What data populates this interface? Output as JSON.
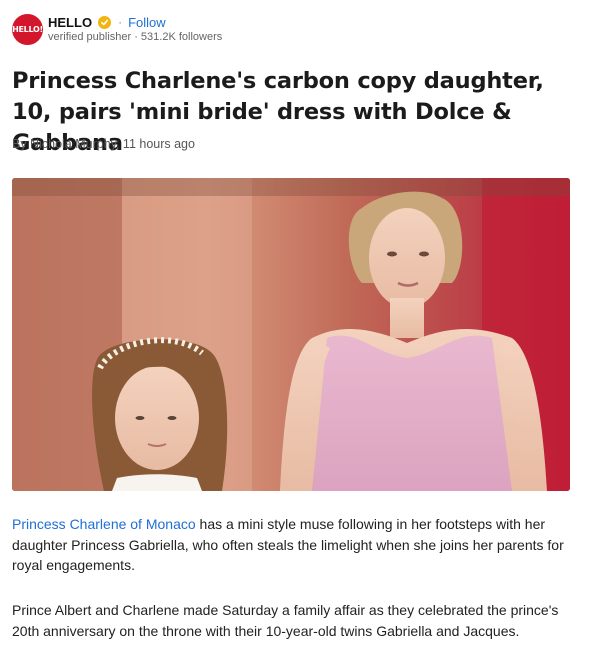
{
  "publisher": {
    "logo_text": "HELLO!",
    "name": "HELLO",
    "verified_icon": "verified-badge-icon",
    "separator": "·",
    "follow_label": "Follow",
    "meta": "verified publisher · 531.2K followers"
  },
  "article": {
    "title": "Princess Charlene's carbon copy daughter, 10, pairs 'mini bride' dress with Dolce & Gabbana",
    "byline": "By Nichola Murphy, 11 hours ago",
    "paragraph1": {
      "link_text": "Princess Charlene of Monaco",
      "rest": " has a mini style muse following in her footsteps with her daughter Princess Gabriella, who often steals the limelight when she joins her parents for royal engagements."
    },
    "paragraph2": "Prince Albert and Charlene made Saturday a family affair as they celebrated the prince's 20th anniversary on the throne with their 10-year-old twins Gabriella and Jacques."
  },
  "colors": {
    "accent_link": "#1f6fd6",
    "brand_red": "#d3162b",
    "verified_gold": "#f2b411"
  }
}
